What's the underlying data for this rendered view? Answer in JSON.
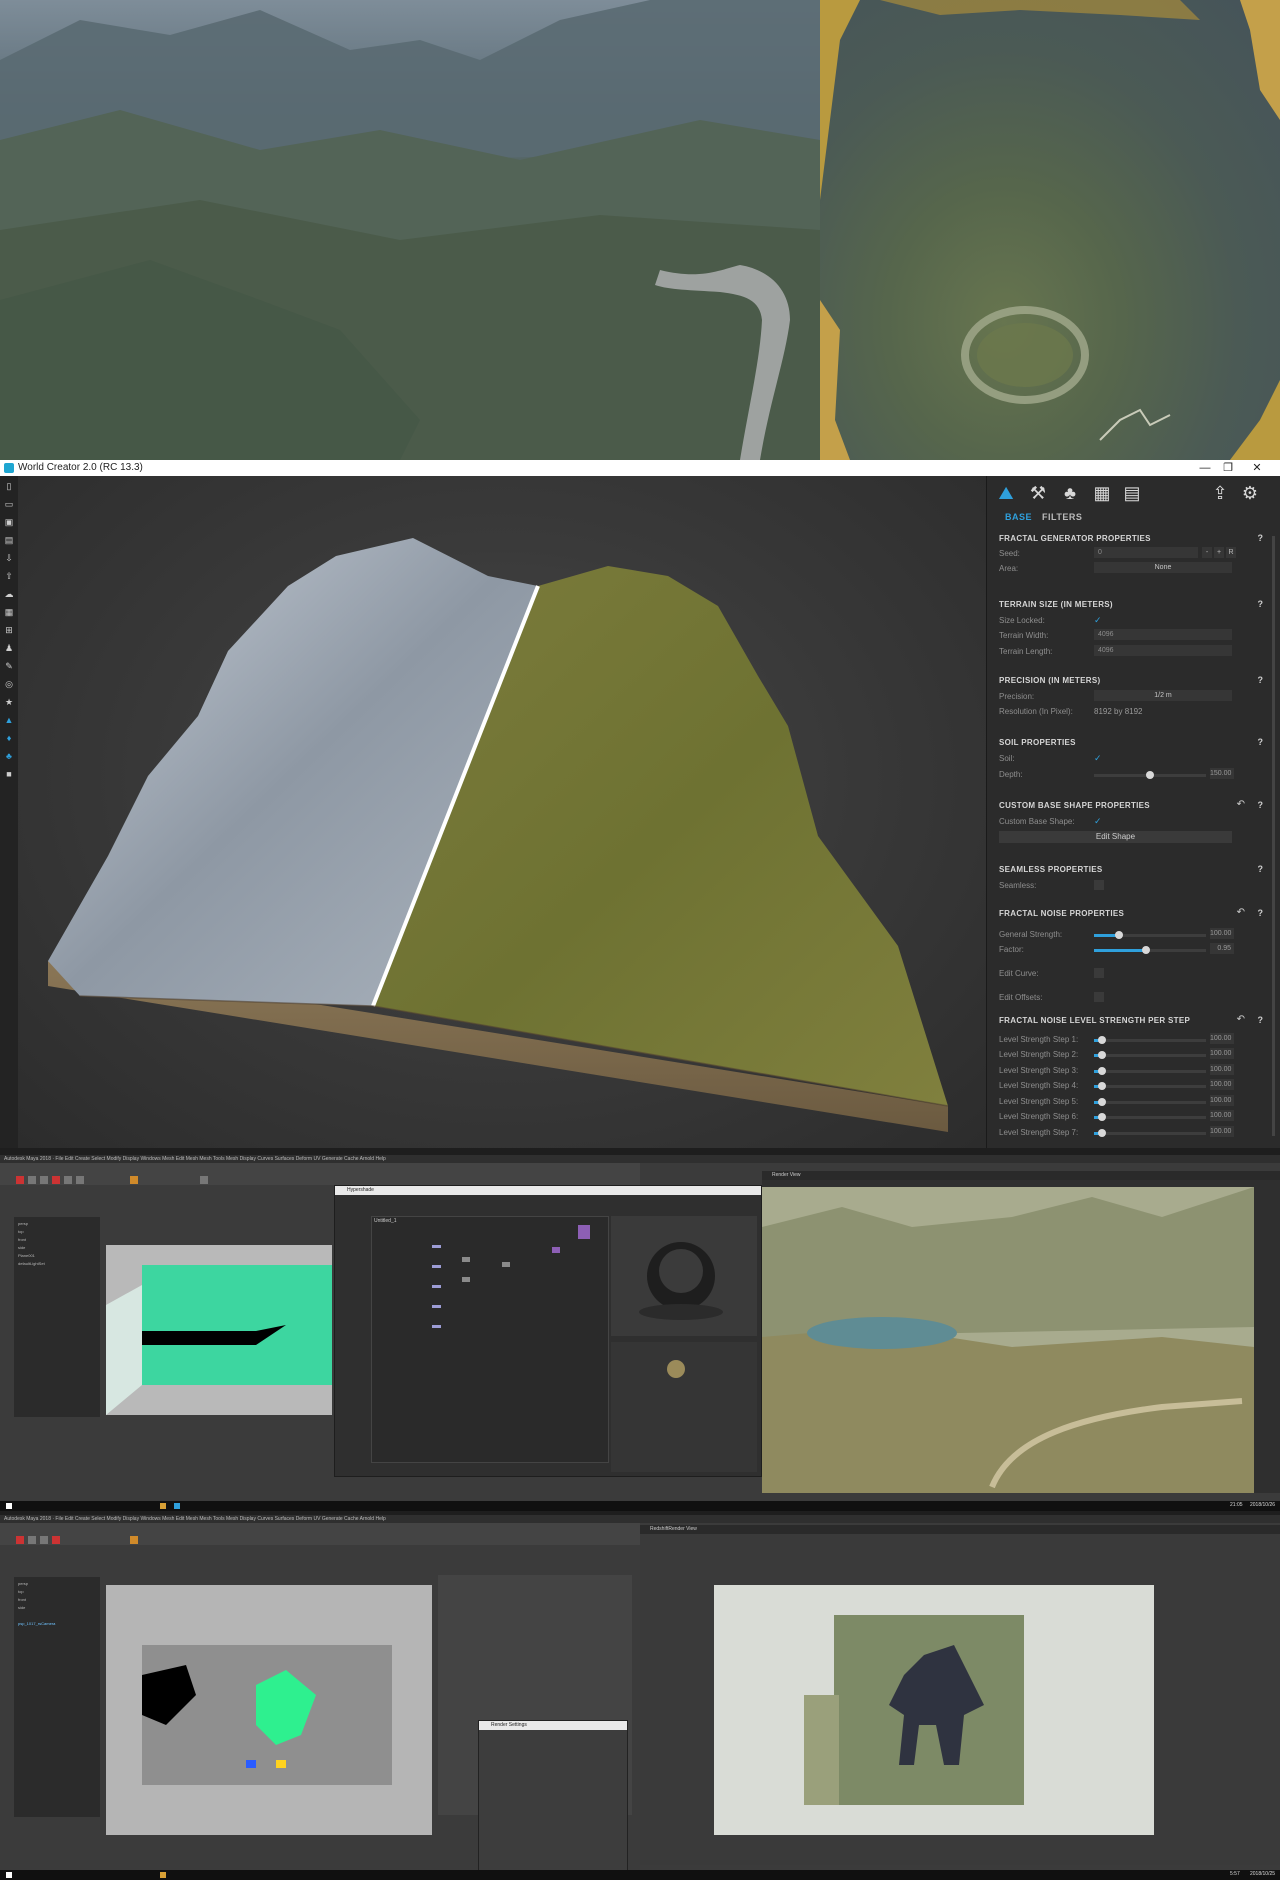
{
  "world_creator": {
    "window_title": "World Creator 2.0 (RC 13.3)",
    "window_controls": {
      "minimize": "—",
      "maximize": "❐",
      "close": "✕"
    },
    "toolbar_icons": [
      "new-file-icon",
      "open-folder-icon",
      "save-icon",
      "save-as-icon",
      "export-icon",
      "import-icon",
      "clouds-icon",
      "map-icon",
      "grid-icon",
      "stamp-icon",
      "brush-icon",
      "globe-icon",
      "star-icon",
      "mountain-icon",
      "fill-icon",
      "erosion-icon",
      "camera-icon"
    ],
    "panel_icons": [
      "terrain-icon",
      "tools-icon",
      "trees-icon",
      "map-icon",
      "layers-icon",
      "share-icon",
      "gear-icon"
    ],
    "tabs": [
      {
        "label": "BASE",
        "active": true
      },
      {
        "label": "FILTERS",
        "active": false
      }
    ],
    "sections": {
      "fractal_generator": {
        "title": "FRACTAL GENERATOR PROPERTIES",
        "help": "?",
        "seed_label": "Seed:",
        "seed_value": "0",
        "seed_buttons": [
          "-",
          "+",
          "R"
        ],
        "area_label": "Area:",
        "area_value": "None"
      },
      "terrain_size": {
        "title": "TERRAIN SIZE (IN METERS)",
        "help": "?",
        "size_locked_label": "Size Locked:",
        "size_locked": "✓",
        "width_label": "Terrain Width:",
        "width_value": "4096",
        "length_label": "Terrain Length:",
        "length_value": "4096"
      },
      "precision": {
        "title": "PRECISION (IN METERS)",
        "help": "?",
        "precision_label": "Precision:",
        "precision_value": "1/2 m",
        "resolution_label": "Resolution (In Pixel):",
        "resolution_value": "8192 by 8192"
      },
      "soil": {
        "title": "SOIL PROPERTIES",
        "help": "?",
        "soil_label": "Soil:",
        "soil_check": "✓",
        "depth_label": "Depth:",
        "depth_value": "150.00",
        "depth_fraction": 0.5
      },
      "custom_base_shape": {
        "title": "CUSTOM BASE SHAPE PROPERTIES",
        "help": "?",
        "reset": "↶",
        "label": "Custom Base Shape:",
        "check": "✓",
        "button": "Edit Shape"
      },
      "seamless": {
        "title": "SEAMLESS PROPERTIES",
        "help": "?",
        "label": "Seamless:"
      },
      "fractal_noise": {
        "title": "FRACTAL NOISE PROPERTIES",
        "help": "?",
        "reset": "↶",
        "strength_label": "General Strength:",
        "strength_value": "100.00",
        "strength_fraction": 0.22,
        "factor_label": "Factor:",
        "factor_value": "0.95",
        "factor_fraction": 0.46,
        "edit_curve_label": "Edit Curve:",
        "edit_offsets_label": "Edit Offsets:"
      },
      "level_strength": {
        "title": "FRACTAL NOISE LEVEL STRENGTH PER STEP",
        "help": "?",
        "reset": "↶",
        "steps": [
          {
            "label": "Level Strength Step 1:",
            "value": "100.00",
            "fraction": 0.07
          },
          {
            "label": "Level Strength Step 2:",
            "value": "100.00",
            "fraction": 0.07
          },
          {
            "label": "Level Strength Step 3:",
            "value": "100.00",
            "fraction": 0.07
          },
          {
            "label": "Level Strength Step 4:",
            "value": "100.00",
            "fraction": 0.07
          },
          {
            "label": "Level Strength Step 5:",
            "value": "100.00",
            "fraction": 0.07
          },
          {
            "label": "Level Strength Step 6:",
            "value": "100.00",
            "fraction": 0.07
          },
          {
            "label": "Level Strength Step 7:",
            "value": "100.00",
            "fraction": 0.07
          }
        ]
      }
    },
    "accent_color": "#2fa0dc"
  },
  "maya_1": {
    "window_title": "Autodesk Maya 2018",
    "hypershade_title": "Hypershade",
    "hypershade_tab": "Untitled_1",
    "render_view_title": "Render View",
    "taskbar_time": "21:05",
    "taskbar_date": "2018/10/26"
  },
  "maya_2": {
    "window_title": "Autodesk Maya 2018",
    "render_view_title": "RedshiftRender View",
    "render_settings_title": "Render Settings",
    "taskbar_time": "5:57",
    "taskbar_date": "2018/10/25"
  }
}
